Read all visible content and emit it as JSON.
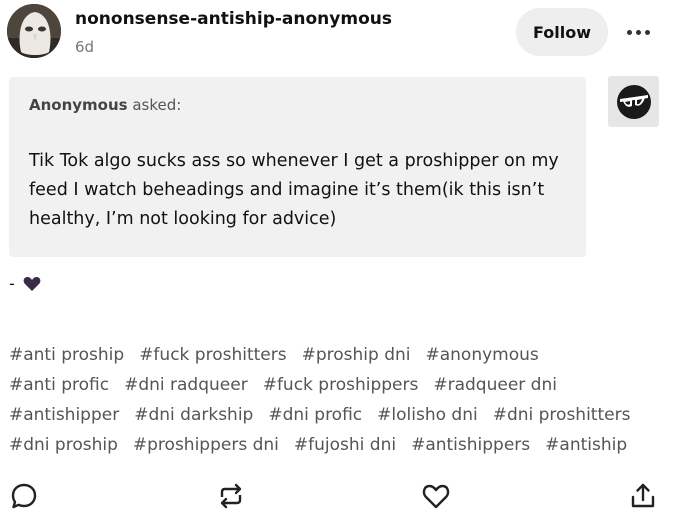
{
  "post": {
    "blog_name": "nononsense-antiship-anonymous",
    "time_ago": "6d",
    "follow_label": "Follow"
  },
  "ask": {
    "asker": "Anonymous",
    "asked_label": " asked:",
    "question": "Tik Tok algo sucks ass so whenever I get a proshipper on my feed I watch beheadings and imagine it’s them(ik this isn’t healthy, I’m not looking for advice)"
  },
  "answer": {
    "text": "-",
    "emoji_icon": "purple-heart-icon",
    "emoji_color": "#3b2b4a"
  },
  "tags": [
    [
      "#anti proship",
      "#fuck proshitters",
      "#proship dni",
      "#anonymous"
    ],
    [
      "#anti profic",
      "#dni radqueer",
      "#fuck proshippers",
      "#radqueer dni"
    ],
    [
      "#antishipper",
      "#dni darkship",
      "#dni profic",
      "#lolisho dni",
      "#dni proshitters"
    ],
    [
      "#dni proship",
      "#proshippers dni",
      "#fujoshi dni",
      "#antishippers",
      "#antiship"
    ]
  ],
  "actions": [
    "reply-icon",
    "reblog-icon",
    "like-icon",
    "share-icon"
  ],
  "colors": {
    "ask_background": "#f1f1f1",
    "follow_background": "#eeeeee",
    "tag_text": "#555555"
  }
}
